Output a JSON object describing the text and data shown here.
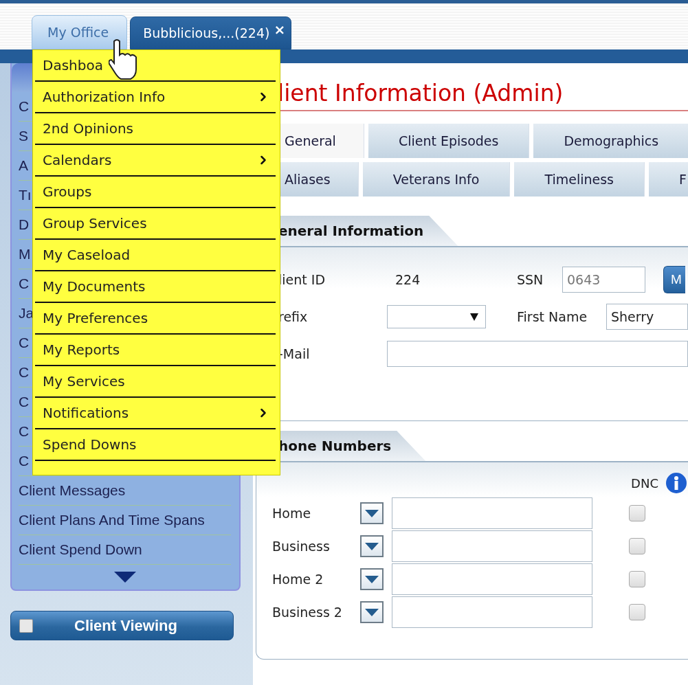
{
  "top_tabs": [
    {
      "label": "My Office",
      "selected": true
    },
    {
      "label": "Bubblicious,...(224)",
      "selected": false,
      "close_label": "×"
    }
  ],
  "menu": {
    "items": [
      {
        "label": "Dashboa",
        "submenu": false
      },
      {
        "label": "Authorization Info",
        "submenu": true
      },
      {
        "label": "2nd Opinions",
        "submenu": false
      },
      {
        "label": "Calendars",
        "submenu": true
      },
      {
        "label": "Groups",
        "submenu": false
      },
      {
        "label": "Group Services",
        "submenu": false
      },
      {
        "label": "My Caseload",
        "submenu": false
      },
      {
        "label": "My Documents",
        "submenu": false
      },
      {
        "label": "My Preferences",
        "submenu": false
      },
      {
        "label": "My Reports",
        "submenu": false
      },
      {
        "label": "My Services",
        "submenu": false
      },
      {
        "label": "Notifications",
        "submenu": true
      },
      {
        "label": "Spend Downs",
        "submenu": false
      }
    ]
  },
  "sidebar": {
    "items": [
      {
        "label": "C"
      },
      {
        "label": "S"
      },
      {
        "label": "A"
      },
      {
        "label": "Tı"
      },
      {
        "label": "D"
      },
      {
        "label": "M"
      },
      {
        "label": "C"
      },
      {
        "label": "Ja"
      },
      {
        "label": "C"
      },
      {
        "label": "C"
      },
      {
        "label": "C"
      },
      {
        "label": "C"
      },
      {
        "label": "C"
      },
      {
        "label": "Client Messages"
      },
      {
        "label": "Client Plans And Time Spans"
      },
      {
        "label": "Client Spend Down"
      }
    ],
    "client_viewing": {
      "label": "Client Viewing",
      "checked": false
    }
  },
  "content": {
    "title": "lient Information (Admin)",
    "tab_rows": [
      {
        "tabs": [
          {
            "label": "General",
            "selected": true
          },
          {
            "label": "Client Episodes",
            "selected": false
          },
          {
            "label": "Demographics",
            "selected": false
          }
        ]
      },
      {
        "tabs": [
          {
            "label": "Aliases",
            "selected": false
          },
          {
            "label": "Veterans Info",
            "selected": false
          },
          {
            "label": "Timeliness",
            "selected": false
          },
          {
            "label": "F",
            "selected": false
          }
        ]
      }
    ],
    "general_information": {
      "heading": "eneral Information",
      "client_id": {
        "label": "lient ID",
        "value": "224"
      },
      "ssn": {
        "label": "SSN",
        "value": "0643",
        "button": "M"
      },
      "prefix": {
        "label": "refix"
      },
      "first_name": {
        "label": "First Name",
        "value": "Sherry"
      },
      "email": {
        "label": "-Mail"
      }
    },
    "phone_numbers": {
      "heading": "hone Numbers",
      "dnc_label": "DNC",
      "rows": [
        {
          "label": "Home",
          "dnc": false
        },
        {
          "label": "Business",
          "dnc": false
        },
        {
          "label": "Home 2",
          "dnc": false
        },
        {
          "label": "Business 2",
          "dnc": false
        }
      ]
    }
  }
}
